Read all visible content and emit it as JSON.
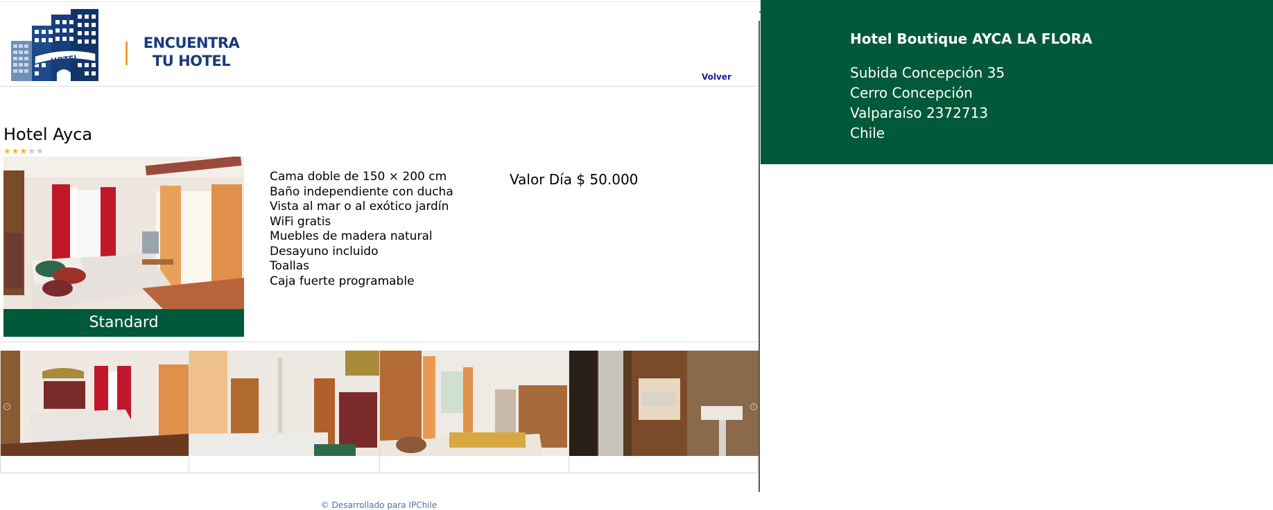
{
  "header": {
    "logo_building_text": "HOTEL",
    "logo_text_line1": "ENCUENTRA",
    "logo_text_line2": "TU HOTEL",
    "back_link": "Volver"
  },
  "hotel": {
    "name": "Hotel Ayca",
    "stars_filled": 3,
    "stars_total": 5
  },
  "room": {
    "type_label": "Standard",
    "amenities": [
      "Cama doble de 150 × 200 cm",
      "Baño independiente con ducha",
      "Vista al mar o al exótico jardín",
      "WiFi gratis",
      "Muebles de madera natural",
      "Desayuno incluido",
      "Toallas",
      "Caja fuerte programable"
    ],
    "price": "Valor Día $ 50.000"
  },
  "footer": {
    "credit": "© Desarrollado para IPChile"
  },
  "info": {
    "title": "Hotel Boutique AYCA LA FLORA",
    "address_line1": "Subida Concepción 35",
    "address_line2": "Cerro Concepción",
    "address_line3": "Valparaíso 2372713",
    "address_line4": "Chile"
  },
  "colors": {
    "brand_green": "#00593a",
    "logo_blue": "#1a3a7a",
    "logo_accent": "#f0a020",
    "star": "#f2b61b"
  }
}
